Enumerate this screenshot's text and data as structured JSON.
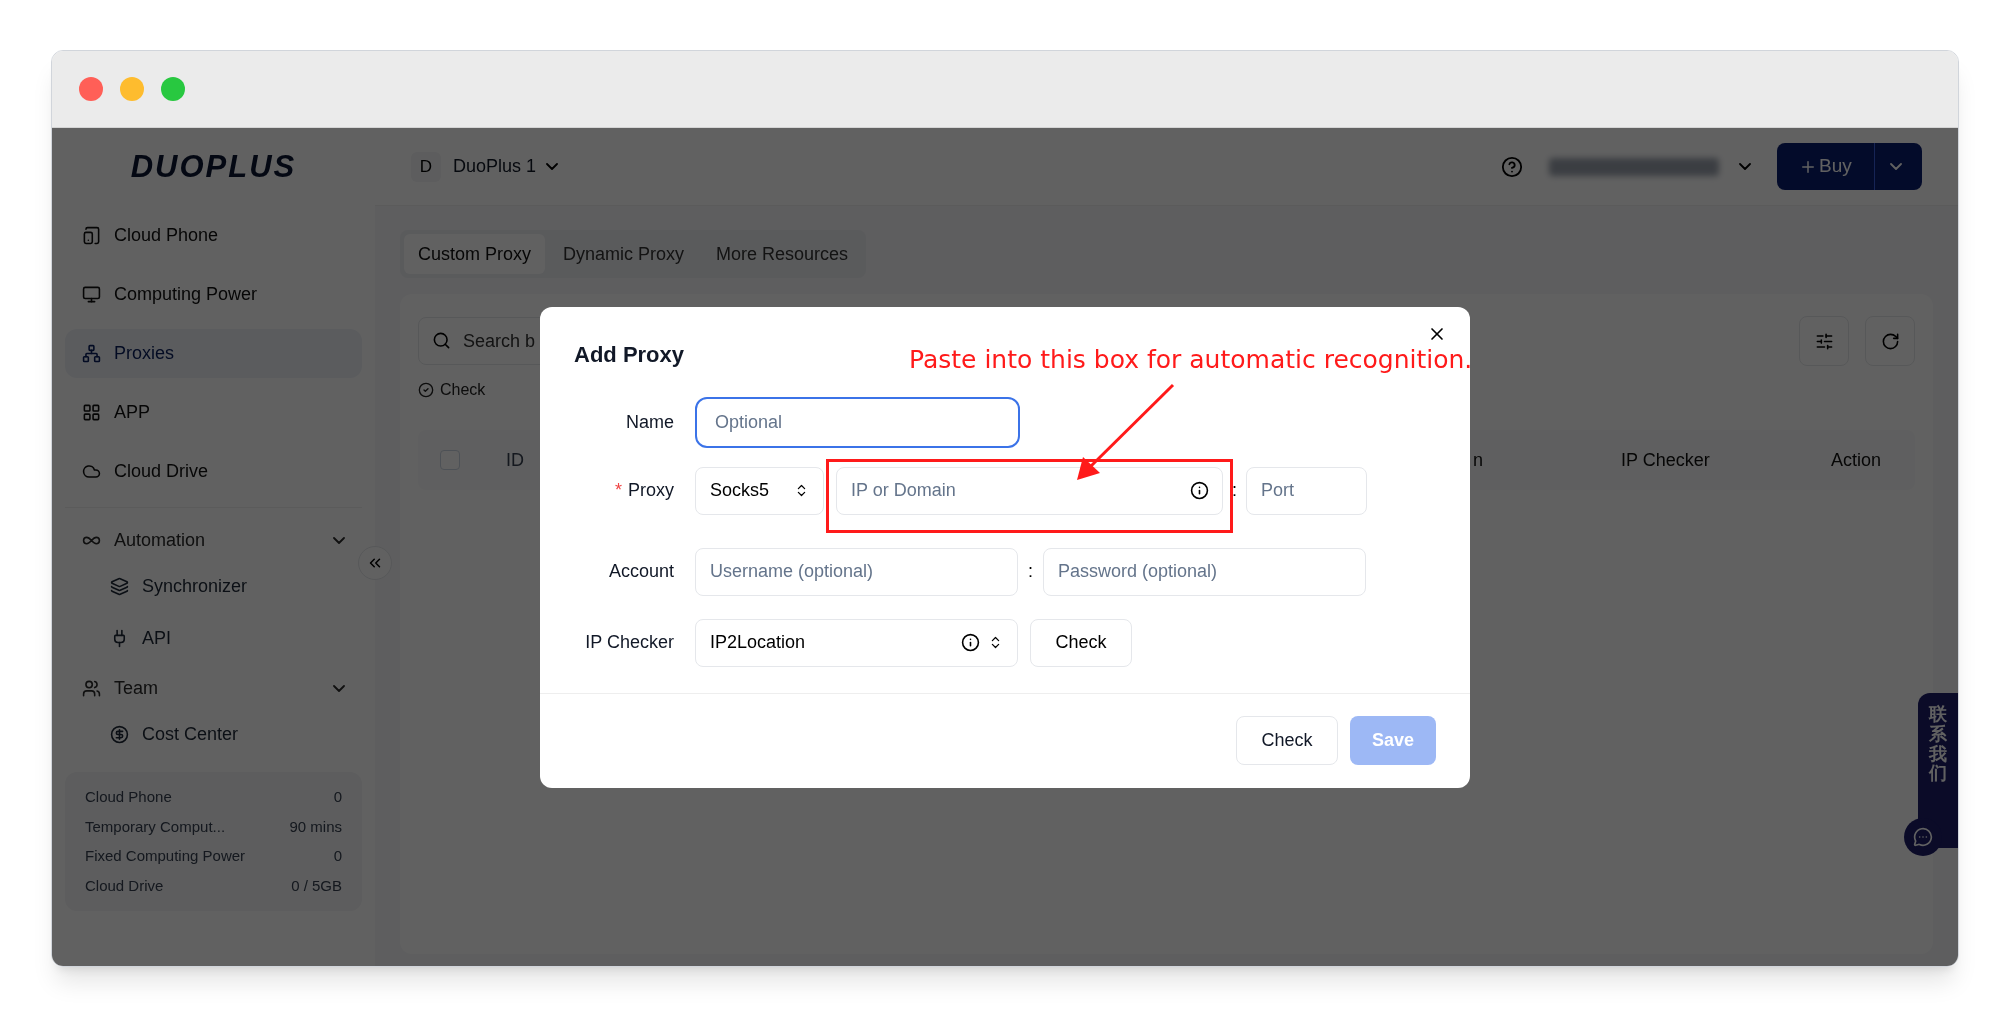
{
  "sidebar": {
    "logo": "DUOPLUS",
    "nav": [
      {
        "kind": "item",
        "label": "Cloud Phone",
        "selected": false
      },
      {
        "kind": "item",
        "label": "Computing Power",
        "selected": false
      },
      {
        "kind": "item",
        "label": "Proxies",
        "selected": true
      },
      {
        "kind": "item",
        "label": "APP",
        "selected": false
      },
      {
        "kind": "item",
        "label": "Cloud Drive",
        "selected": false
      },
      {
        "kind": "group",
        "label": "Automation",
        "expanded": true,
        "children": [
          {
            "label": "Synchronizer",
            "selected": false
          },
          {
            "label": "API",
            "selected": false
          }
        ]
      },
      {
        "kind": "group",
        "label": "Team",
        "expanded": true,
        "children": [
          {
            "label": "Cost Center",
            "selected": false
          }
        ]
      }
    ],
    "usage": [
      {
        "label": "Cloud Phone",
        "value": "0"
      },
      {
        "label": "Temporary Comput...",
        "value": "90 mins"
      },
      {
        "label": "Fixed Computing Power",
        "value": "0"
      },
      {
        "label": "Cloud Drive",
        "value": "0 / 5GB"
      }
    ]
  },
  "topbar": {
    "workspace_initial": "D",
    "workspace": "DuoPlus 1",
    "buy": "Buy"
  },
  "tabs": [
    {
      "label": "Custom Proxy",
      "selected": true
    },
    {
      "label": "Dynamic Proxy",
      "selected": false
    },
    {
      "label": "More Resources",
      "selected": false
    }
  ],
  "search": {
    "placeholder": "Search b"
  },
  "toolbar": {
    "check": "Check"
  },
  "table": {
    "select_all_checked": false,
    "columns": [
      "ID",
      "n",
      "IP Checker",
      "Action"
    ]
  },
  "dialog": {
    "title": "Add Proxy",
    "name": {
      "label": "Name",
      "placeholder": "Optional",
      "focused": true
    },
    "proxy": {
      "label": "Proxy",
      "required_mark": "*",
      "type": "Socks5",
      "host_placeholder": "IP or Domain",
      "separator": ":",
      "port_placeholder": "Port"
    },
    "account": {
      "label": "Account",
      "username_placeholder": "Username (optional)",
      "separator": ":",
      "password_placeholder": "Password (optional)"
    },
    "ip_checker": {
      "label": "IP Checker",
      "value": "IP2Location",
      "check": "Check"
    },
    "buttons": [
      {
        "label": "Check",
        "disabled": false,
        "primary": false
      },
      {
        "label": "Save",
        "disabled": true,
        "primary": true
      }
    ],
    "annotation": "Paste into this box for automatic recognition."
  },
  "contact": "联系我们"
}
